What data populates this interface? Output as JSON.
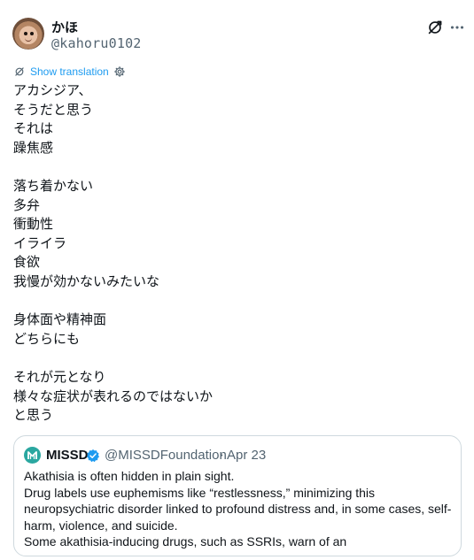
{
  "author": {
    "display_name": "かほ",
    "handle": "@kahoru0102"
  },
  "translate": {
    "label": "Show translation"
  },
  "tweet": {
    "lines": [
      "アカシジア、",
      "そうだと思う",
      "それは",
      "躁焦感",
      "",
      "落ち着かない",
      "多弁",
      "衝動性",
      "イライラ",
      "食欲",
      "我慢が効かないみたいな",
      "",
      "身体面や精神面",
      "どちらにも",
      "",
      "それが元となり",
      "様々な症状が表れるのではないか",
      "と思う"
    ]
  },
  "quote": {
    "name": "MISSD",
    "handle": "@MISSDFoundation",
    "separator": "·",
    "date": "Apr 23",
    "lines": [
      "Akathisia is often hidden in plain sight.",
      "Drug labels use euphemisms like “restlessness,” minimizing this",
      "neuropsychiatric disorder linked to profound distress and, in some cases, self-",
      "harm, violence, and suicide.",
      "Some akathisia-inducing drugs, such as SSRIs, warn of an"
    ]
  },
  "colors": {
    "link": "#1d9bf0",
    "secondary_text": "#536471",
    "verified_badge": "#1d9bf0",
    "border": "#cfd9de"
  }
}
